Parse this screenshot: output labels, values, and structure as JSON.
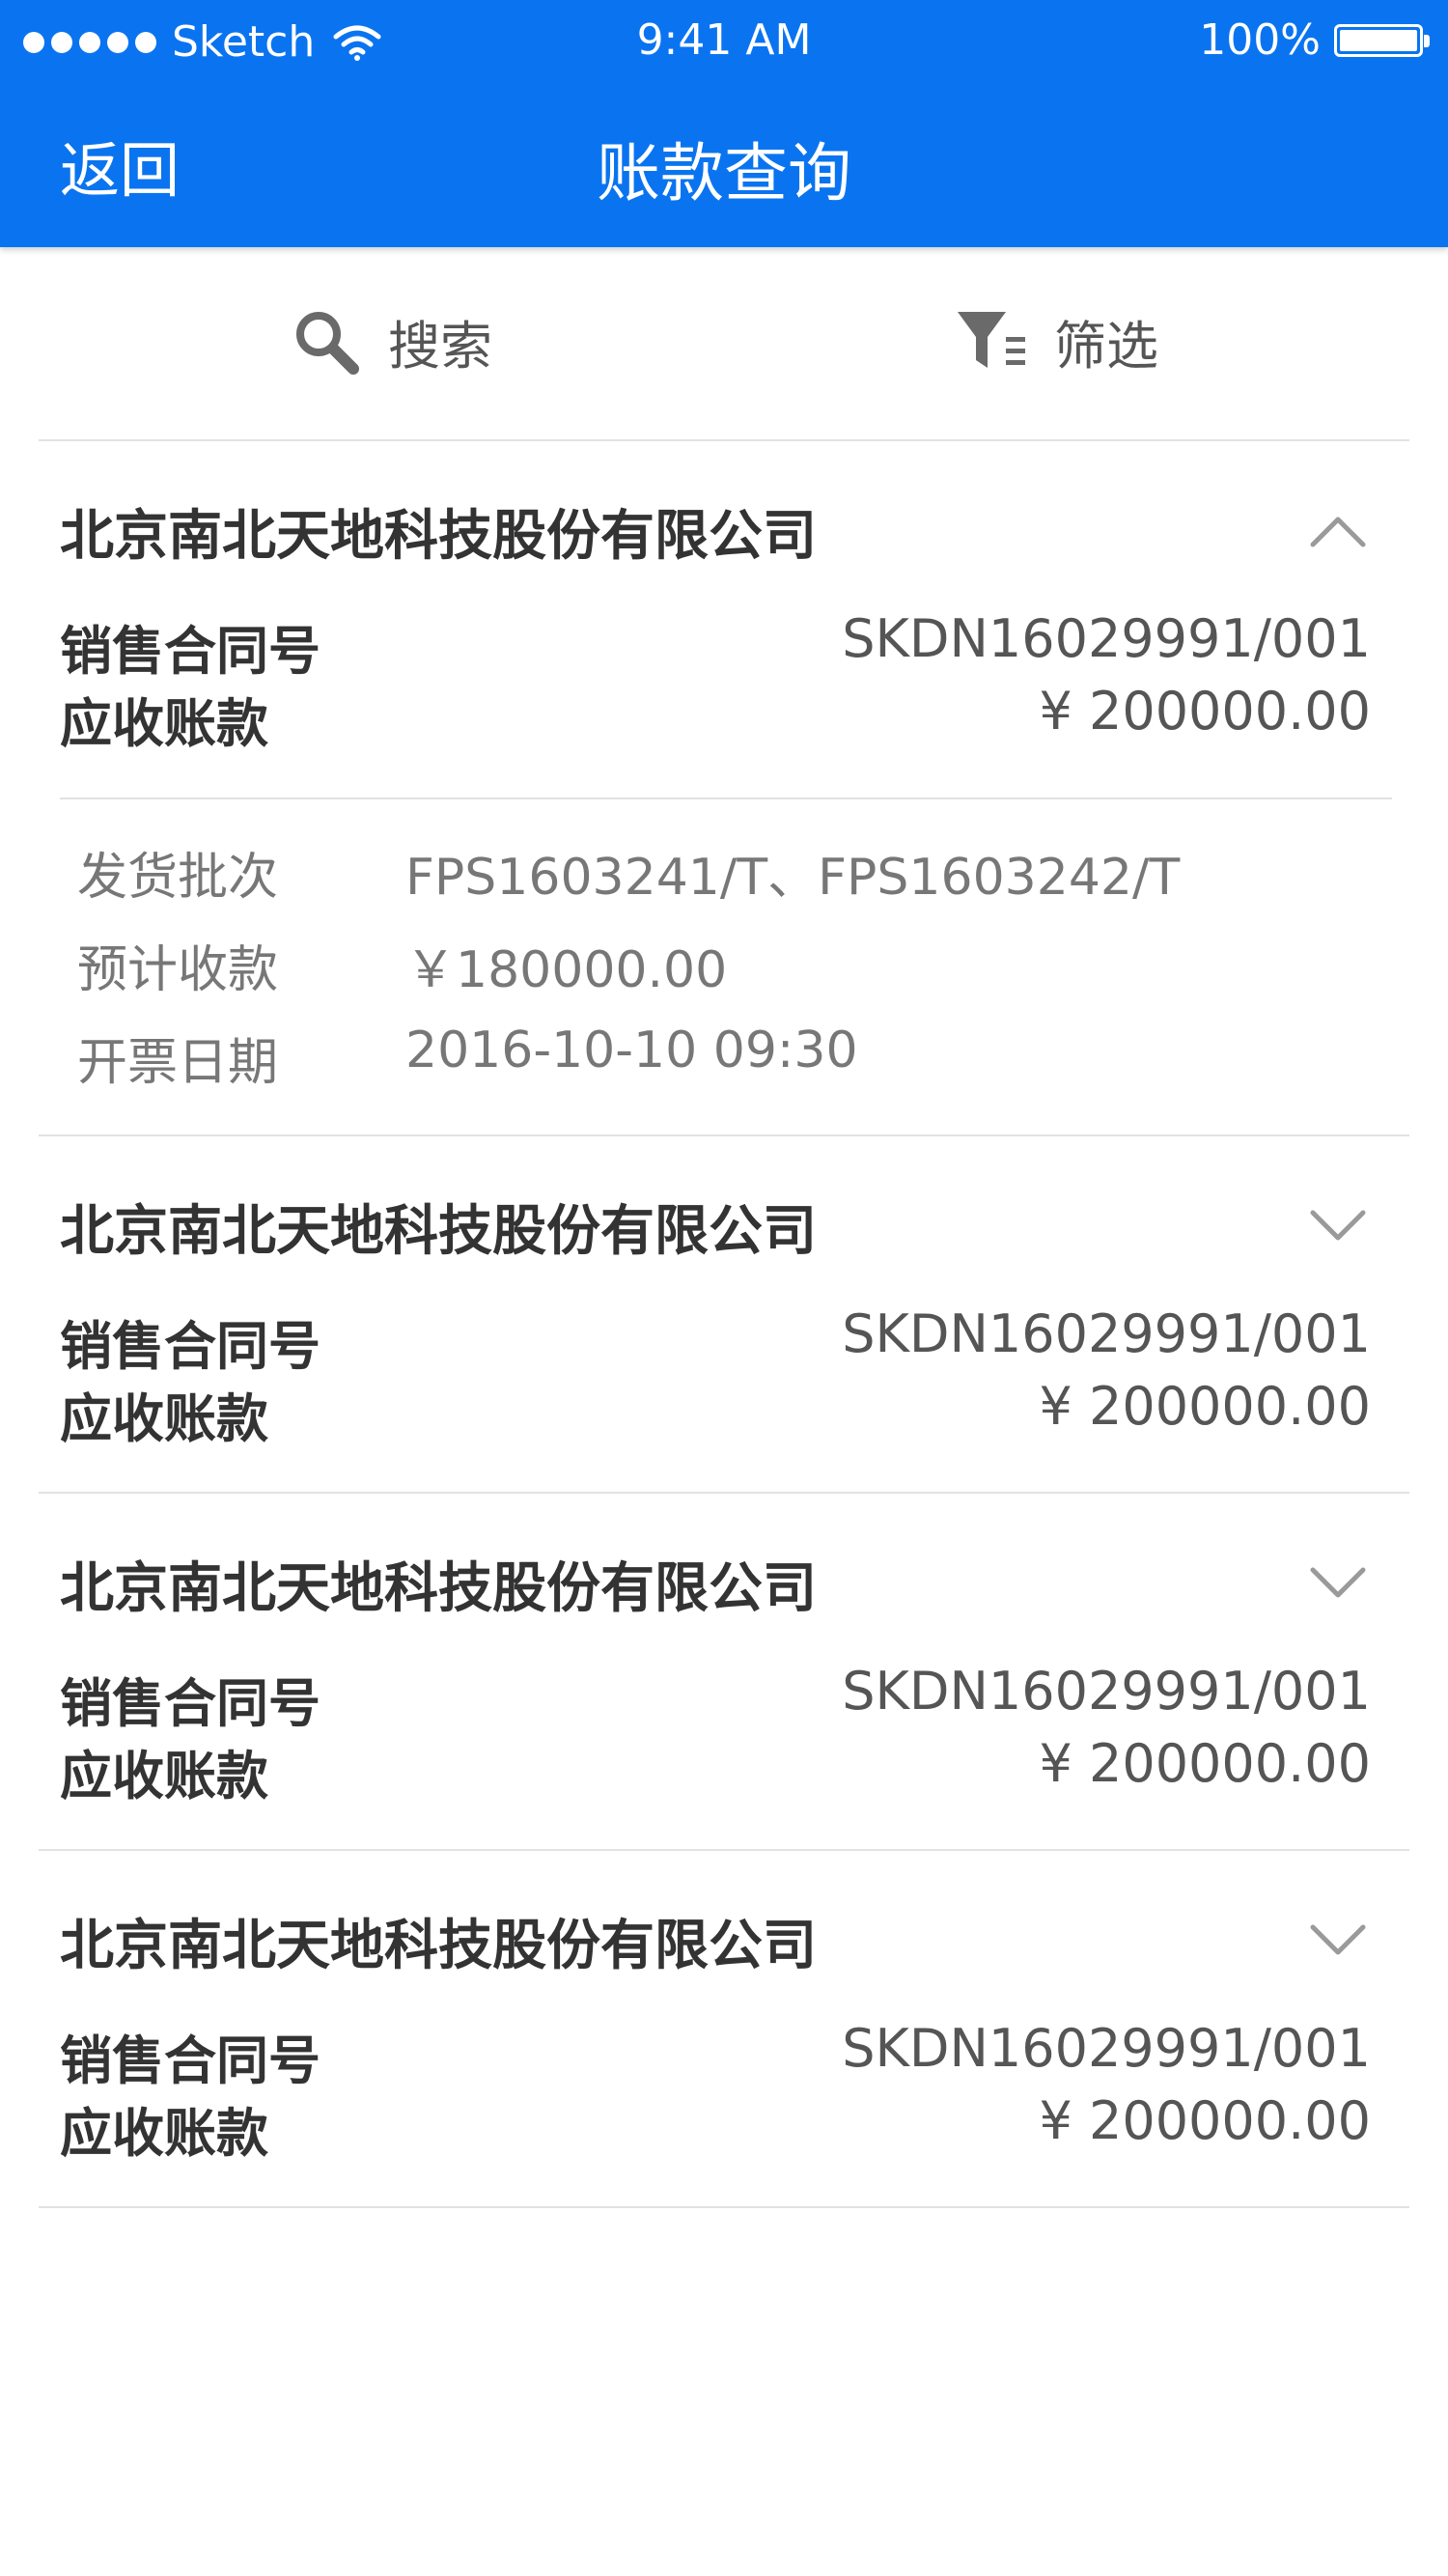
{
  "status_bar": {
    "carrier": "Sketch",
    "time": "9:41 AM",
    "battery": "100%"
  },
  "nav": {
    "back_label": "返回",
    "title": "账款查询"
  },
  "toolbar": {
    "search_label": "搜索",
    "filter_label": "筛选"
  },
  "accounts": [
    {
      "company": "北京南北天地科技股份有限公司",
      "contract_label": "销售合同号",
      "contract_value": "SKDN16029991/001",
      "receivable_label": "应收账款",
      "receivable_value": "¥  200000.00",
      "expanded": true,
      "details": [
        {
          "label": "发货批次",
          "value": "FPS1603241/T、FPS1603242/T"
        },
        {
          "label": "预计收款",
          "value": "￥180000.00"
        },
        {
          "label": "开票日期",
          "value": "2016-10-10   09:30"
        }
      ]
    },
    {
      "company": "北京南北天地科技股份有限公司",
      "contract_label": "销售合同号",
      "contract_value": "SKDN16029991/001",
      "receivable_label": "应收账款",
      "receivable_value": "¥  200000.00",
      "expanded": false
    },
    {
      "company": "北京南北天地科技股份有限公司",
      "contract_label": "销售合同号",
      "contract_value": "SKDN16029991/001",
      "receivable_label": "应收账款",
      "receivable_value": "¥  200000.00",
      "expanded": false
    },
    {
      "company": "北京南北天地科技股份有限公司",
      "contract_label": "销售合同号",
      "contract_value": "SKDN16029991/001",
      "receivable_label": "应收账款",
      "receivable_value": "¥  200000.00",
      "expanded": false
    }
  ],
  "colors": {
    "header": "#0a74f0",
    "divider": "#e2e2e2"
  }
}
